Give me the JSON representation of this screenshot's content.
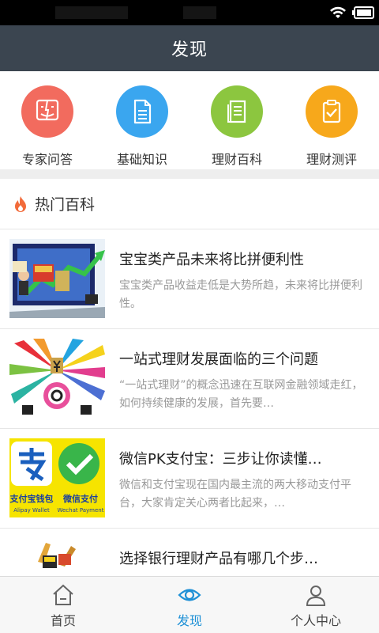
{
  "header": {
    "title": "发现"
  },
  "quick": [
    {
      "label": "专家问答",
      "icon": "expert-chat-icon",
      "color": "#f26b5e"
    },
    {
      "label": "基础知识",
      "icon": "document-icon",
      "color": "#3aa6ef"
    },
    {
      "label": "理财百科",
      "icon": "list-doc-icon",
      "color": "#8cc63f"
    },
    {
      "label": "理财测评",
      "icon": "clipboard-check-icon",
      "color": "#f7a81b"
    }
  ],
  "section": {
    "title": "热门百科",
    "icon": "flame-icon"
  },
  "articles": [
    {
      "title": "宝宝类产品未来将比拼便利性",
      "desc": "宝宝类产品收益走低是大势所趋，未来将比拼便利性。"
    },
    {
      "title": "一站式理财发展面临的三个问题",
      "desc": "“一站式理财”的概念迅速在互联网金融领域走红，如何持续健康的发展，首先要…"
    },
    {
      "title": "微信PK支付宝：三步让你读懂…",
      "desc": "微信和支付宝现在国内最主流的两大移动支付平台，大家肯定关心两者比起来，…",
      "thumb_text": {
        "alipay": "支付宝钱包",
        "alipay_en": "Alipay Wallet",
        "wechat": "微信支付",
        "wechat_en": "Wechat Payment"
      }
    },
    {
      "title": "选择银行理财产品有哪几个步…",
      "desc": ""
    }
  ],
  "tabs": [
    {
      "label": "首页",
      "icon": "home-icon",
      "active": false
    },
    {
      "label": "发现",
      "icon": "eye-icon",
      "active": true
    },
    {
      "label": "个人中心",
      "icon": "user-icon",
      "active": false
    }
  ],
  "colors": {
    "header_bg": "#3b4550",
    "accent": "#1e90d6"
  }
}
